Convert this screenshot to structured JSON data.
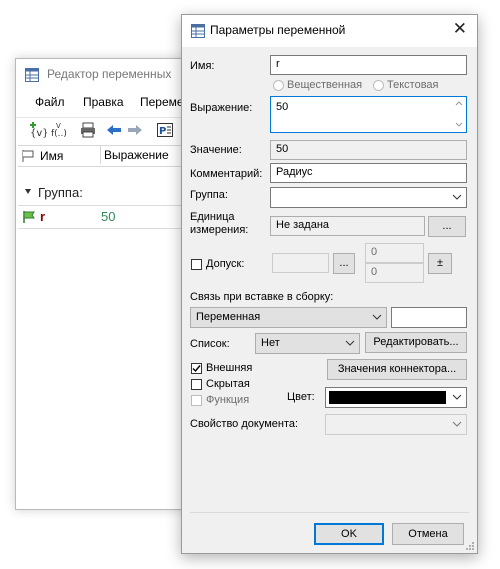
{
  "editor": {
    "title": "Редактор переменных",
    "menu": [
      "Файл",
      "Правка",
      "Переме"
    ],
    "columns": [
      "Имя",
      "Выражение"
    ],
    "group_label": "Группа:",
    "row": {
      "name": "r",
      "value": "50"
    }
  },
  "dialog": {
    "title": "Параметры переменной",
    "name_label": "Имя:",
    "name_value": "r",
    "radio_real": "Вещественная",
    "radio_text": "Текстовая",
    "expression_label": "Выражение:",
    "expression_value": "50",
    "value_label": "Значение:",
    "value_value": "50",
    "comment_label": "Комментарий:",
    "comment_value": "Радиус",
    "group_label": "Группа:",
    "group_value": "",
    "unit_label_1": "Единица",
    "unit_label_2": "измерения:",
    "unit_value": "Не задана",
    "ellipsis": "...",
    "tolerance_label": "Допуск:",
    "tolerance_upper": "0",
    "tolerance_lower": "0",
    "plusminus": "±",
    "link_label": "Связь при вставке в сборку:",
    "link_value": "Переменная",
    "link_extra": "",
    "list_label": "Список:",
    "list_value": "Нет",
    "edit_button": "Редактировать...",
    "external_label": "Внешняя",
    "hidden_label": "Скрытая",
    "function_label": "Функция",
    "connector_button": "Значения коннектора...",
    "color_label": "Цвет:",
    "color_value": "#000000",
    "docprop_label": "Свойство документа:",
    "ok": "OK",
    "cancel": "Отмена"
  },
  "colors": {
    "accent": "#0078d7",
    "row_name": "#8b0000",
    "row_value": "#2e8b57"
  }
}
